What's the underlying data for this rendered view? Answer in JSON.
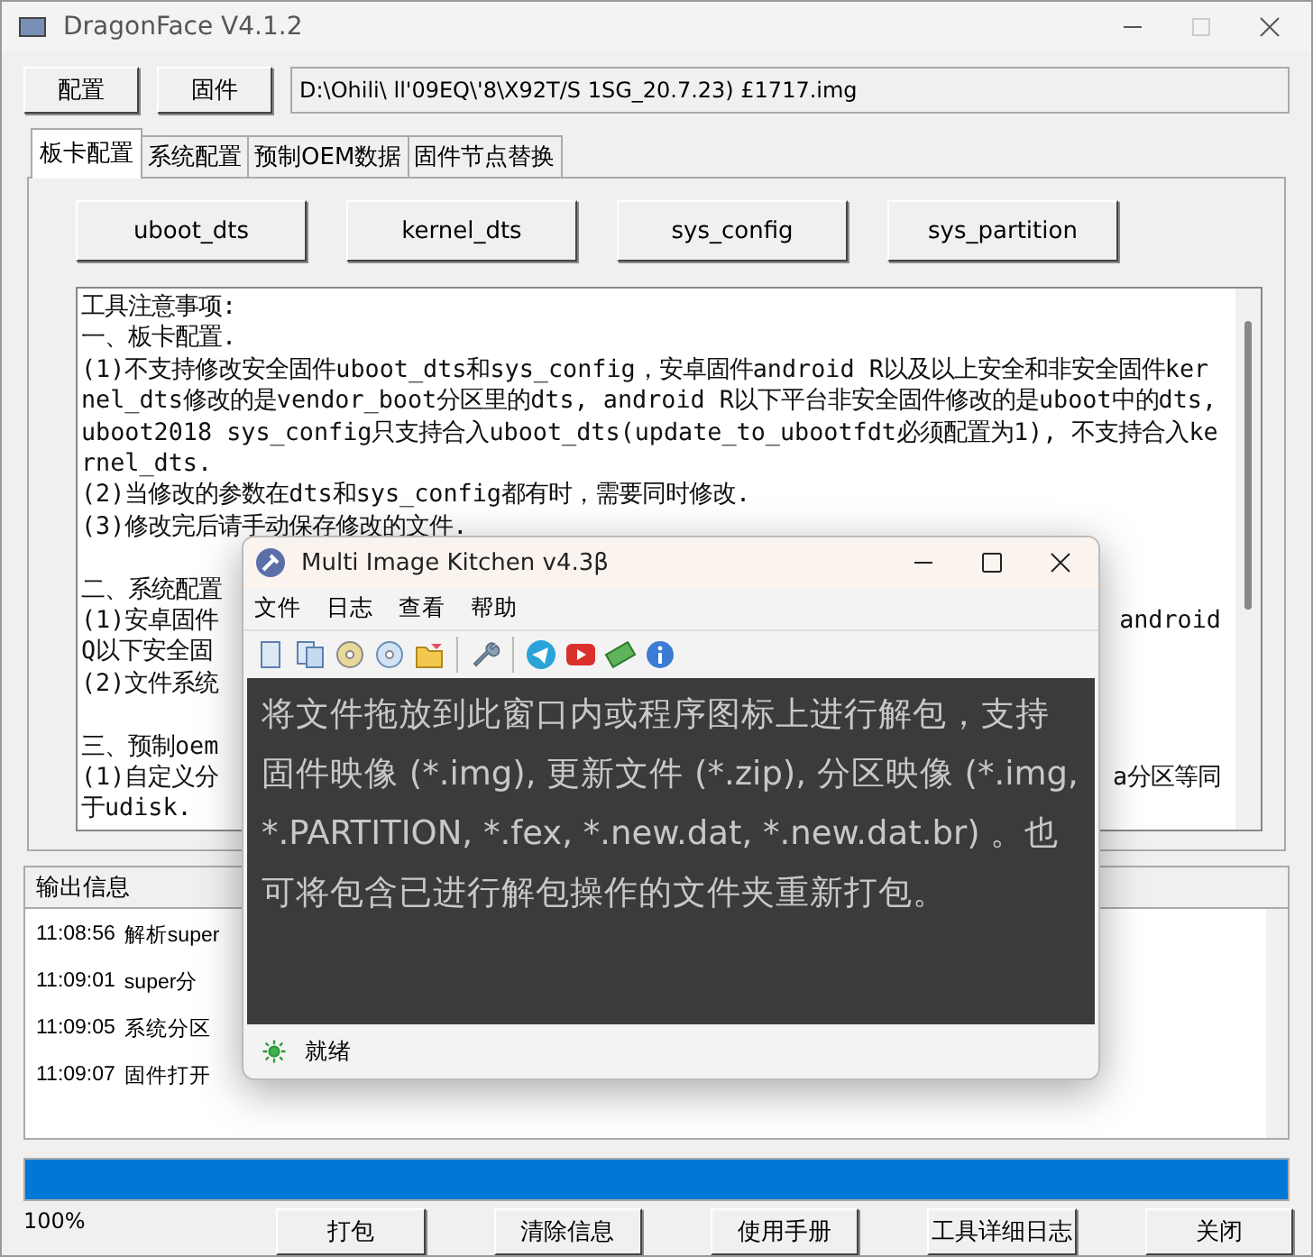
{
  "window": {
    "title": "DragonFace V4.1.2"
  },
  "top_buttons": [
    "配置",
    "固件"
  ],
  "firmware_path": "D:\\Ohili\\ ll'09EQ\\'8\\X92T/S 1SG_20.7.23) £1717.img",
  "tabs": [
    {
      "label": "板卡配置",
      "selected": true
    },
    {
      "label": "系统配置",
      "selected": false
    },
    {
      "label": "预制OEM数据",
      "selected": false
    },
    {
      "label": "固件节点替换",
      "selected": false
    }
  ],
  "panel_buttons": [
    "uboot_dts",
    "kernel_dts",
    "sys_config",
    "sys_partition"
  ],
  "notes": [
    [
      {
        "left": "工具注意事项:"
      },
      {
        "left": "一、板卡配置."
      },
      {
        "left": "(1)不支持修改安全固件uboot_dts和sys_config，安卓固件android R以及以上安全和非安全固件kernel_dts修改的是vendor_boot分区里的dts, android R以下平台非安全固件修改的是uboot中的dts, uboot2018 sys_config只支持合入uboot_dts(update_to_ubootfdt必须配置为1), 不支持合入kernel_dts."
      },
      {
        "left": "(2)当修改的参数在dts和sys_config都有时，需要同时修改."
      },
      {
        "left": "(3)修改完后请手动保存修改的文件."
      }
    ],
    [
      {
        "left": "二、系统配置"
      },
      {
        "left": "(1)安卓固件",
        "right": "android"
      },
      {
        "left": "Q以下安全固"
      },
      {
        "left": "(2)文件系统"
      }
    ],
    [
      {
        "left": "三、预制oem"
      },
      {
        "left": "(1)自定义分",
        "right": "a分区等同"
      },
      {
        "left": "于udisk."
      }
    ]
  ],
  "output": {
    "title": "输出信息",
    "rows": [
      {
        "time": "11:08:56",
        "message": "解析super"
      },
      {
        "time": "11:09:01",
        "message": "super分"
      },
      {
        "time": "11:09:05",
        "message": "系统分区"
      },
      {
        "time": "11:09:07",
        "message": "固件打开"
      }
    ]
  },
  "progress": {
    "level": 1,
    "reading": "100%"
  },
  "bottom_buttons": [
    "打包",
    "清除信息",
    "使用手册",
    "工具详细日志",
    "关闭"
  ],
  "kitchen": {
    "title": "Multi Image Kitchen v4.3β",
    "menu": [
      "文件",
      "日志",
      "查看",
      "帮助"
    ],
    "drop_hint": "将文件拖放到此窗口内或程序图标上进行解包，支持固件映像 (*.img), 更新文件 (*.zip), 分区映像 (*.img, *.PARTITION, *.fex, *.new.dat, *.new.dat.br) 。也可将包含已进行解包操作的文件夹重新打包。",
    "status": "就绪"
  }
}
